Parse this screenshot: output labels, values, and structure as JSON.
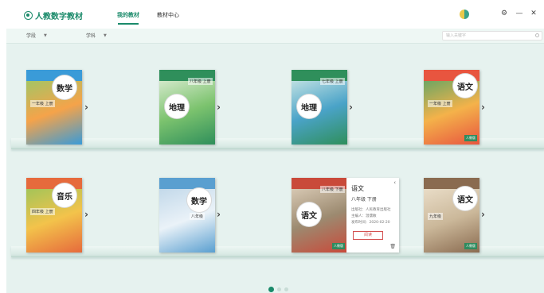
{
  "app": {
    "title": "人教数字教材",
    "brand_color": "#1a8a6a"
  },
  "nav": {
    "tabs": [
      {
        "label": "我的教材",
        "active": true
      },
      {
        "label": "教材中心",
        "active": false
      }
    ]
  },
  "window_controls": {
    "settings": "⚙",
    "minimize": "—",
    "close": "✕"
  },
  "filters": {
    "stage": {
      "label": "学段"
    },
    "subject": {
      "label": "学科"
    },
    "search_placeholder": "输入关键字"
  },
  "shelves": [
    {
      "books": [
        {
          "subject": "数学",
          "grade": "一年级 上册",
          "cover": [
            "#3a9bd8",
            "#f5a34a",
            "#8fce6b"
          ]
        },
        {
          "subject": "地理",
          "grade": "八年级 上册",
          "cover": [
            "#2f8f5b",
            "#7cc36e",
            "#e9f2e2"
          ]
        },
        {
          "subject": "地理",
          "grade": "七年级 上册",
          "cover": [
            "#2f8f5b",
            "#4aa3c8",
            "#dcefe8"
          ]
        },
        {
          "subject": "语文",
          "grade": "一年级 上册",
          "cover": [
            "#e8553f",
            "#f4b24a",
            "#4aa36a"
          ],
          "badge": "人教版"
        }
      ]
    },
    {
      "books": [
        {
          "subject": "音乐",
          "grade": "四年级 上册",
          "cover": [
            "#e66a3c",
            "#f3c34b",
            "#8ec45c"
          ]
        },
        {
          "subject": "数学",
          "grade": "八年级",
          "cover": [
            "#5a9fd0",
            "#eaf2f8",
            "#b8d2e6"
          ]
        },
        {
          "subject": "语文",
          "grade": "八年级 下册",
          "cover": [
            "#c94a3a",
            "#9c8a70",
            "#e6d8c4"
          ],
          "badge": "人教版"
        },
        {
          "subject": "语文",
          "grade": "九年级",
          "cover": [
            "#8a6b50",
            "#cbb89a",
            "#f1e6d3"
          ],
          "badge": "人教版"
        }
      ]
    }
  ],
  "detail": {
    "title": "语文",
    "subtitle": "八年级 下册",
    "publisher": "出版社：人民教育出版社",
    "editor": "主编人：温儒敏",
    "date": "发布时间：2020-02-20",
    "read_button": "阅读"
  },
  "pagination": {
    "pages": 3,
    "current": 1
  }
}
